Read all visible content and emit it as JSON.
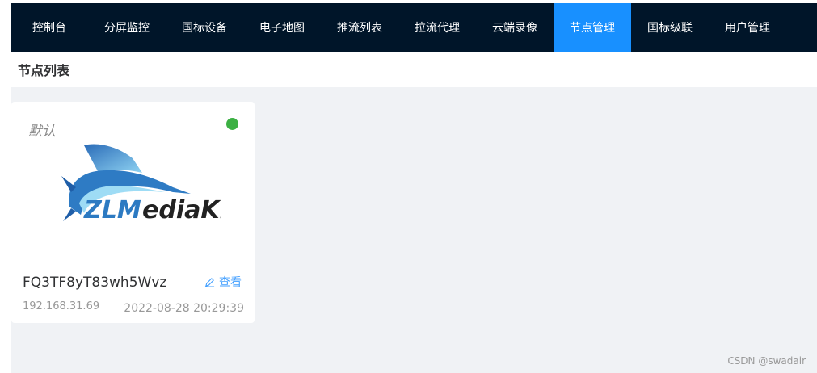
{
  "nav": {
    "items": [
      {
        "label": "控制台"
      },
      {
        "label": "分屏监控"
      },
      {
        "label": "国标设备"
      },
      {
        "label": "电子地图"
      },
      {
        "label": "推流列表"
      },
      {
        "label": "拉流代理"
      },
      {
        "label": "云端录像"
      },
      {
        "label": "节点管理",
        "active": true
      },
      {
        "label": "国标级联"
      },
      {
        "label": "用户管理"
      }
    ]
  },
  "page": {
    "title": "节点列表"
  },
  "node_card": {
    "tag": "默认",
    "status": "online",
    "status_color": "#3cb043",
    "logo_text_zl": "ZLM",
    "logo_text_rest": "ediaKit",
    "name": "FQ3TF8yT83wh5Wvz",
    "view_label": "查看",
    "ip": "192.168.31.69",
    "time": "2022-08-28 20:29:39"
  },
  "watermark": "CSDN @swadair",
  "colors": {
    "nav_bg": "#001529",
    "nav_active": "#1890ff",
    "link": "#409eff",
    "page_bg": "#f0f2f5"
  }
}
